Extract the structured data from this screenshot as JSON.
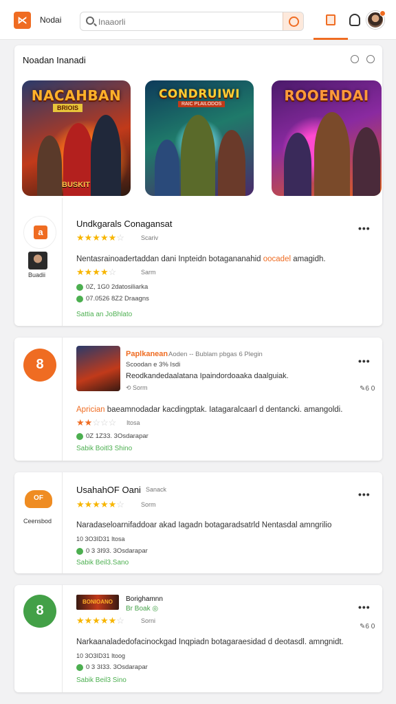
{
  "header": {
    "app_name": "Nodai",
    "search_placeholder": "Inaaorli",
    "colors": {
      "accent": "#ef6c22",
      "green": "#4caf50"
    }
  },
  "featured": {
    "title": "Noadan Inanadi",
    "games": [
      {
        "name": "NACAHBAN",
        "subtitle": "BRIOIS",
        "badge": "BUSKIT"
      },
      {
        "name": "CONDRUIWI",
        "subtitle": "RAIC PLAILODOS"
      },
      {
        "name": "ROOENDAI"
      }
    ]
  },
  "items": [
    {
      "logo_text": "a",
      "title": "Undkgarals Conagansat",
      "rating_label": "Scariv",
      "avatar_name": "Buadii",
      "desc_text": "Nentasrainoadertaddan dani Inpteidn botagananahid ",
      "desc_highlight": "oocadel",
      "desc_end": " amagidh.",
      "sub_rating_label": "Sarm",
      "meta1": "0Z, 1G0 2datosiliarka",
      "meta2": "07.0526 8Z2 Draagns",
      "link": "Sattia  an JoBhlato"
    },
    {
      "logo_text": "8",
      "publisher": "Paplkanean",
      "publisher_meta": "Aoden -- Bublam pbgas 6 Plegin",
      "line2": "Scoodan e 3% Isdi",
      "line3": "Reodkandedaalatana Ipaindordoaaka daalguiak.",
      "rating_label": "Sorm",
      "share": "6 0",
      "desc_highlight_start": "Aprician",
      "desc_text": " baeamnodadar kacdingptak. Iatagaralcaarl d dentancki. amangoldi.",
      "sub_rating_label": "Itosa",
      "meta1": "0Z 1Z33. 3Osdarapar",
      "link": "Sabik Boitl3 Shino"
    },
    {
      "logo_text": "OF",
      "logo_label": "Ceensbod",
      "title": "UsahahOF Oani",
      "title_meta": "Sanack",
      "rating_label": "Sorm",
      "desc_text": "Naradaseloarnifaddoar akad Iagadn botagaradsatrld Nentasdal amngrilio",
      "sub_line": "10 3O3ID31 Itosa",
      "meta1": "0 3 3I93. 3Osdarapar",
      "link": "Sabik Beil3.Sano"
    },
    {
      "logo_text": "8",
      "banner_text": "BONIOANO",
      "publisher": "Borighamnn",
      "publisher_sub": "Br Boak",
      "rating_label": "Sorni",
      "share": "6 0",
      "desc_text": "Narkaanaladedofacinockgad Inqpiadn botagaraesidad d deotasdl. amngnidt.",
      "sub_line": "10 3O3ID31 Itoog",
      "meta1": "0 3 3I33. 3Osdarapar",
      "link": "Sabik Beil3 Sino"
    }
  ]
}
